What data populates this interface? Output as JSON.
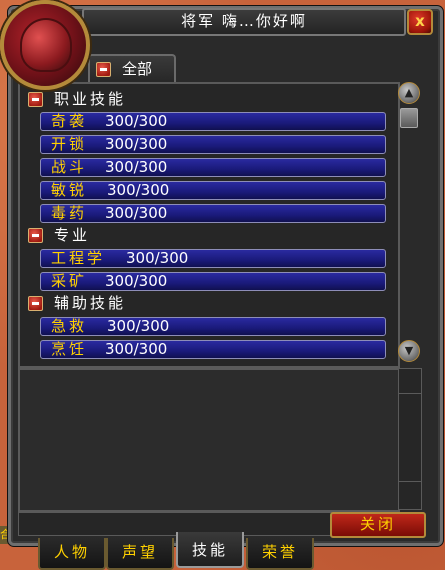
{
  "window": {
    "title": "将军 嗨…你好啊",
    "close_x": "x",
    "filter_label": "全部"
  },
  "groups": [
    {
      "label": "职业技能",
      "skills": [
        {
          "name": "奇袭",
          "value": "300/300"
        },
        {
          "name": "开锁",
          "value": "300/300"
        },
        {
          "name": "战斗",
          "value": "300/300"
        },
        {
          "name": "敏锐",
          "value": "300/300"
        },
        {
          "name": "毒药",
          "value": "300/300"
        }
      ]
    },
    {
      "label": "专业",
      "skills": [
        {
          "name": "工程学",
          "value": "300/300"
        },
        {
          "name": "采矿",
          "value": "300/300"
        }
      ]
    },
    {
      "label": "辅助技能",
      "skills": [
        {
          "name": "急救",
          "value": "300/300"
        },
        {
          "name": "烹饪",
          "value": "300/300"
        }
      ]
    }
  ],
  "buttons": {
    "close": "关闭"
  },
  "tabs": [
    "人物",
    "声望",
    "技能",
    "荣誉"
  ],
  "left_stub": "合",
  "colors": {
    "skill_name": "#ffd100",
    "skill_bar": "#1a1a7a",
    "close_button": "#a01a10"
  }
}
